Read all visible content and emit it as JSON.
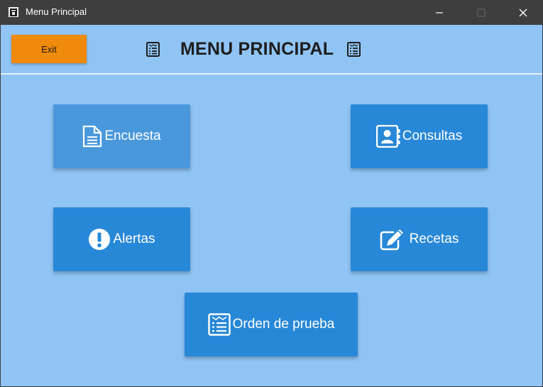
{
  "window": {
    "title": "Menu Principal",
    "controls": {
      "minimize": "—",
      "maximize": "☐",
      "close": "✕"
    }
  },
  "toolbar": {
    "exit_label": "Exit"
  },
  "header": {
    "title": "MENU PRINCIPAL",
    "icon": "list-icon"
  },
  "menu": {
    "encuesta": {
      "label": "Encuesta",
      "icon": "document-icon"
    },
    "consultas": {
      "label": "Consultas",
      "icon": "contact-book-icon"
    },
    "alertas": {
      "label": "Alertas",
      "icon": "exclamation-icon"
    },
    "recetas": {
      "label": "Recetas",
      "icon": "edit-icon"
    },
    "orden": {
      "label": "Orden de prueba",
      "icon": "list-icon"
    }
  },
  "colors": {
    "background": "#90c4f4",
    "button": "#2888d8",
    "button_highlight": "#4a98dc",
    "exit": "#f08a0c",
    "titlebar": "#3e3e3e"
  }
}
